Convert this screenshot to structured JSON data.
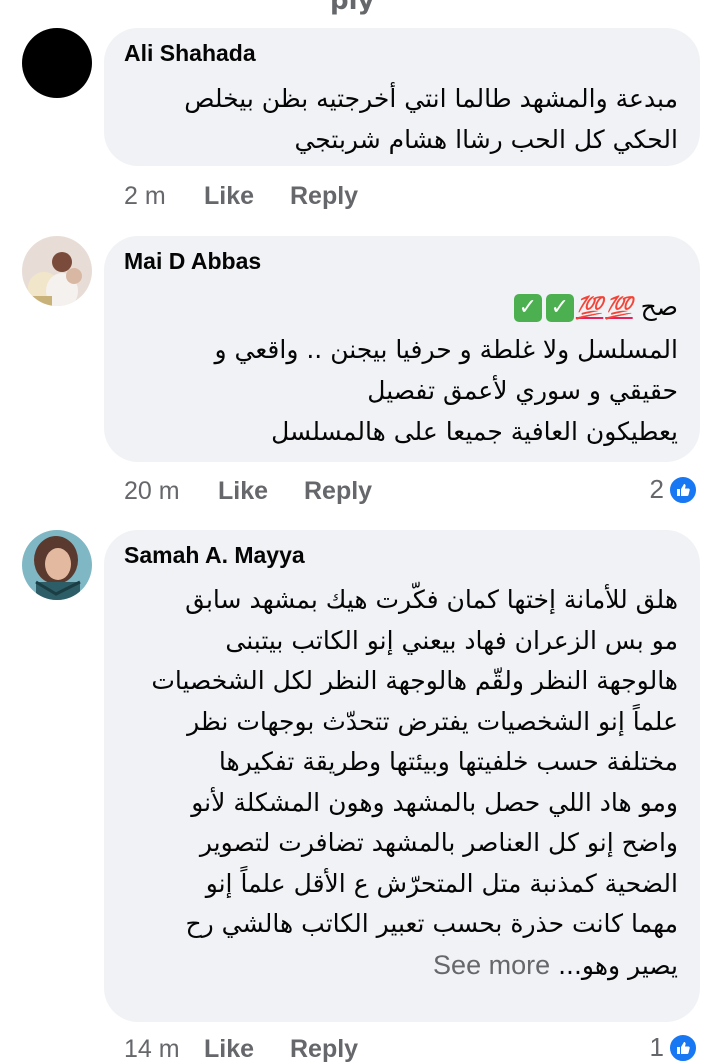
{
  "top_fragment": "ply",
  "comments": [
    {
      "author": "Ali Shahada",
      "lines": [
        "مبدعة والمشهد طالما انتي أخرجتيه بظن بيخلص",
        "الحكي كل الحب رشاا هشام شربتجي"
      ],
      "time": "2 m",
      "like_label": "Like",
      "reply_label": "Reply",
      "reaction_count": null
    },
    {
      "author": "Mai D Abbas",
      "first_line_text": "صح",
      "first_line_emojis": [
        "💯",
        "💯",
        "✅",
        "✅"
      ],
      "lines": [
        "المسلسل ولا غلطة و حرفيا بيجنن .. واقعي و",
        "حقيقي و سوري لأعمق تفصيل",
        "يعطيكون العافية جميعا على هالمسلسل"
      ],
      "time": "20 m",
      "like_label": "Like",
      "reply_label": "Reply",
      "reaction_count": "2"
    },
    {
      "author": "Samah A. Mayya",
      "lines": [
        "هلق للأمانة إختها كمان فكّرت هيك بمشهد سابق",
        "مو بس الزعران فهاد بيعني إنو الكاتب بيتبنى",
        "هالوجهة النظر ولقّم هالوجهة النظر لكل الشخصيات",
        "علماً إنو الشخصيات يفترض تتحدّث بوجهات نظر",
        "مختلفة حسب خلفيتها وبيئتها وطريقة تفكيرها",
        "ومو هاد اللي حصل بالمشهد وهون المشكلة لأنو",
        "واضح إنو كل العناصر بالمشهد تضافرت لتصوير",
        "الضحية كمذنبة متل المتحرّش ع الأقل علماً إنو",
        "مهما كانت حذرة بحسب تعبير الكاتب هالشي رح"
      ],
      "last_line_text": "يصير وهو...",
      "see_more_label": "See more",
      "time": "14 m",
      "like_label": "Like",
      "reply_label": "Reply",
      "reaction_count": "1"
    }
  ]
}
